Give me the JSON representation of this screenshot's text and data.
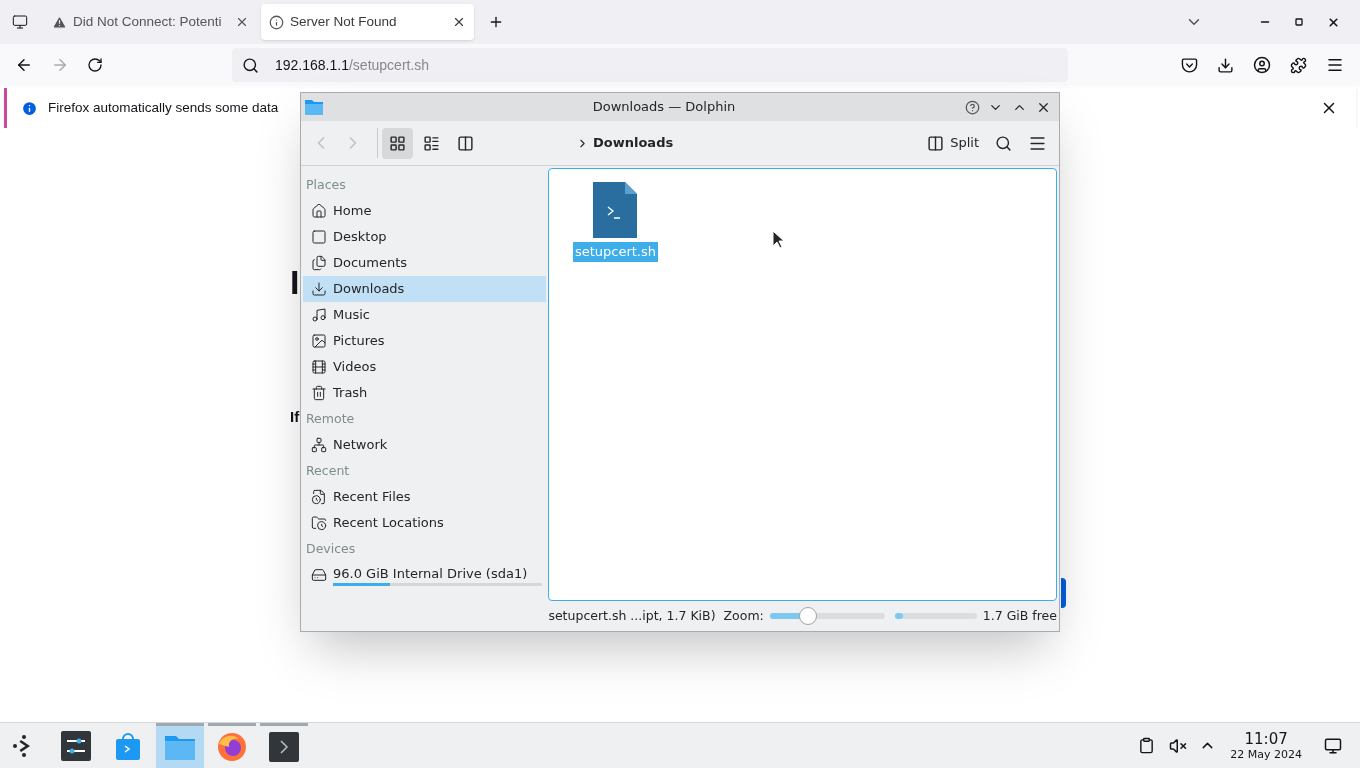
{
  "browser": {
    "tabs": [
      {
        "title": "Did Not Connect: Potenti",
        "selected": false
      },
      {
        "title": "Server Not Found",
        "selected": true
      }
    ],
    "url": {
      "host": "192.168.1.1",
      "path": "/setupcert.sh"
    },
    "notification": "Firefox automatically sends some data"
  },
  "page": [
    {
      "kind": "heading",
      "text": "I"
    },
    {
      "kind": "bold",
      "text": "If"
    }
  ],
  "dolphin": {
    "title": "Downloads — Dolphin",
    "view_modes": [
      {
        "selected": true
      },
      {
        "selected": false
      },
      {
        "selected": false
      }
    ],
    "breadcrumb": "Downloads",
    "split_label": "Split",
    "sidebar": [
      {
        "heading": "Places",
        "items": [
          {
            "label": "Home",
            "selected": false
          },
          {
            "label": "Desktop",
            "selected": false
          },
          {
            "label": "Documents",
            "selected": false
          },
          {
            "label": "Downloads",
            "selected": true
          },
          {
            "label": "Music",
            "selected": false
          },
          {
            "label": "Pictures",
            "selected": false
          },
          {
            "label": "Videos",
            "selected": false
          },
          {
            "label": "Trash",
            "selected": false
          }
        ]
      },
      {
        "heading": "Remote",
        "items": [
          {
            "label": "Network",
            "selected": false
          }
        ]
      },
      {
        "heading": "Recent",
        "items": [
          {
            "label": "Recent Files",
            "selected": false
          },
          {
            "label": "Recent Locations",
            "selected": false
          }
        ]
      },
      {
        "heading": "Devices",
        "items": [
          {
            "label": "96.0 GiB Internal Drive (sda1)",
            "selected": false,
            "level": 0.27
          }
        ]
      }
    ],
    "files": [
      {
        "name": "setupcert.sh",
        "selected": true
      }
    ],
    "status": "setupcert.sh ...ipt, 1.7 KiB)",
    "zoom_label": "Zoom:",
    "zoom": {
      "level": 0.3
    },
    "space": {
      "level": 0.1
    },
    "free_text": "1.7 GiB free"
  },
  "taskbar": {
    "apps": [
      {
        "selected": false,
        "running": false
      },
      {
        "selected": false,
        "running": false
      },
      {
        "selected": false,
        "running": false
      },
      {
        "selected": true,
        "running": true
      },
      {
        "selected": false,
        "running": true
      },
      {
        "selected": false,
        "running": true
      }
    ],
    "time": "11:07",
    "date": "22 May 2024"
  }
}
